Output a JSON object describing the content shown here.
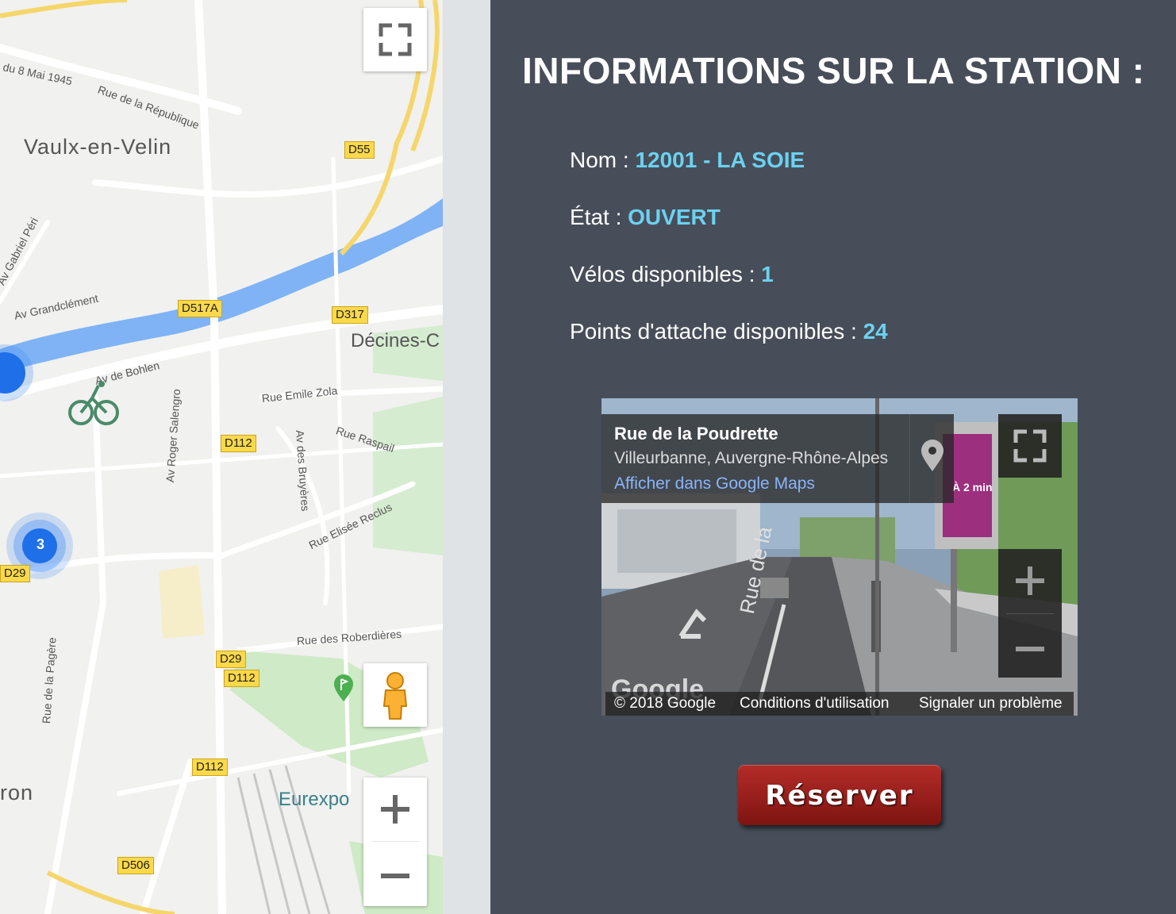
{
  "map": {
    "towns": {
      "vaulx": "Vaulx-en-Velin",
      "decines": "Décines-C",
      "eurexpo": "Eurexpo",
      "bron": "ron"
    },
    "roads": {
      "mai1945": "du 8 Mai 1945",
      "republique": "Rue de la République",
      "gabriel_peri": "Av Gabriel Péri",
      "grandclement": "Av Grandclément",
      "bohlen": "Av de Bohlen",
      "emile_zola": "Rue Emile Zola",
      "raspail": "Rue Raspail",
      "roger_salengro": "Av Roger Salengro",
      "bruyeres": "Av des Bruyères",
      "elisee_reclus": "Rue Elisée Reclus",
      "roberdieres": "Rue des Roberdières",
      "pagere": "Rue de la Pagère"
    },
    "shields": {
      "d55": "D55",
      "d517a": "D517A",
      "d317": "D317",
      "d112a": "D112",
      "d29a": "D29",
      "d29b": "D29",
      "d112b": "D112",
      "d112c": "D112",
      "d506": "D506"
    },
    "cluster_count": "3",
    "icons": [
      "fullscreen-icon",
      "pegman-icon",
      "zoom-in-icon",
      "zoom-out-icon",
      "bicycle-icon",
      "golf-icon"
    ]
  },
  "panel": {
    "title": "INFORMATIONS SUR LA STATION :",
    "nom_label": "Nom : ",
    "nom_value": "12001 - LA SOIE",
    "etat_label": "État : ",
    "etat_value": "OUVERT",
    "velos_label": "Vélos disponibles : ",
    "velos_value": "1",
    "points_label": "Points d'attache disponibles : ",
    "points_value": "24",
    "accent_color": "#6cd1f0"
  },
  "streetview": {
    "street": "Rue de la Poudrette",
    "place": "Villeurbanne, Auvergne-Rhône-Alpes",
    "link": "Afficher dans Google Maps",
    "copyright": "© 2018 Google",
    "terms": "Conditions d'utilisation",
    "report": "Signaler un problème",
    "watermark": "Google",
    "sign_text": "À 2 min",
    "road_text": "Rue de la"
  },
  "reserve_label": "Réserver"
}
